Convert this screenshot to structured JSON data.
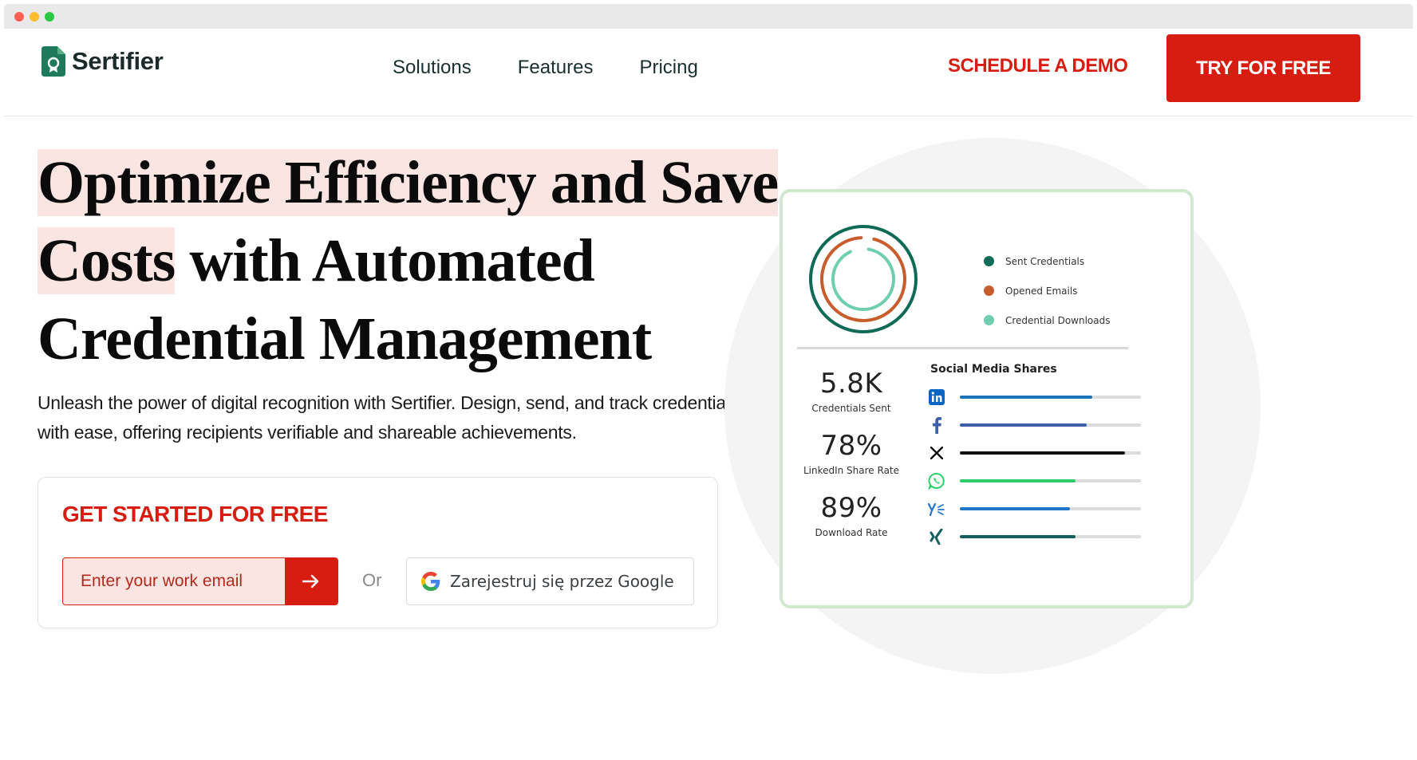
{
  "nav": {
    "brand": "Sertifier",
    "links": [
      "Solutions",
      "Features",
      "Pricing"
    ],
    "demo": "SCHEDULE A DEMO",
    "try": "TRY FOR FREE"
  },
  "hero": {
    "title_hl_1": "Optimize Efficiency and Save",
    "title_hl_2": "Costs",
    "title_rest_2": " with Automated",
    "title_3": "Credential Management",
    "subtitle_1": "Unleash the power of digital recognition with Sertifier. Design, send, and track credentials",
    "subtitle_2": "with ease, offering recipients verifiable and shareable achievements."
  },
  "signup": {
    "title": "GET STARTED FOR FREE",
    "email_placeholder": "Enter your work email",
    "or": "Or",
    "google": "Zarejestruj się przez Google"
  },
  "dashboard": {
    "legend": [
      {
        "label": "Sent Credentials",
        "color": "#0f6b55"
      },
      {
        "label": "Opened Emails",
        "color": "#c95c2c"
      },
      {
        "label": "Credential Downloads",
        "color": "#6fcdb0"
      }
    ],
    "stats": [
      {
        "value": "5.8K",
        "label": "Credentials Sent"
      },
      {
        "value": "78%",
        "label": "LinkedIn Share Rate"
      },
      {
        "value": "89%",
        "label": "Download Rate"
      }
    ],
    "shares_title": "Social Media Shares",
    "shares": [
      {
        "icon": "linkedin-icon",
        "fill": 0.73,
        "color": "#1b75bb"
      },
      {
        "icon": "facebook-icon",
        "fill": 0.7,
        "color": "#3b5fa8"
      },
      {
        "icon": "x-icon",
        "fill": 0.91,
        "color": "#111111"
      },
      {
        "icon": "whatsapp-icon",
        "fill": 0.64,
        "color": "#2ecc6b"
      },
      {
        "icon": "yammer-icon",
        "fill": 0.61,
        "color": "#1e78c8"
      },
      {
        "icon": "xing-icon",
        "fill": 0.64,
        "color": "#146060"
      }
    ]
  },
  "colors": {
    "accent": "#d61d10",
    "highlight": "#fbe5e2"
  }
}
